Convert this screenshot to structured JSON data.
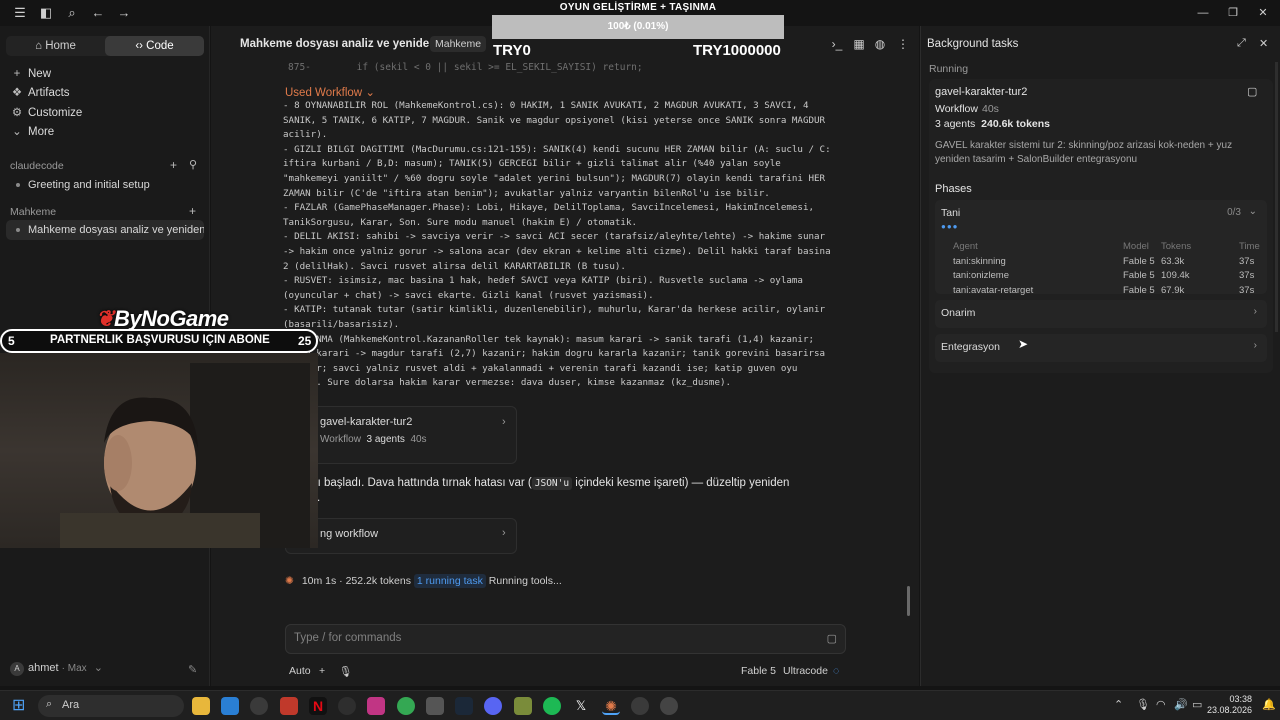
{
  "overlay": {
    "title": "OYUN GELİŞTİRME + TAŞINMA",
    "progress_text": "100₺ (0.01%)",
    "progress_fraction": 0.0001,
    "goal_start": "TRY0",
    "goal_end": "TRY1000000",
    "brand": "ByNoGame",
    "promo_left": "5",
    "promo_text": "PARTNERLIK BAŞVURUSU IÇIN ABONE",
    "promo_right": "25"
  },
  "sidebar": {
    "tabs": [
      {
        "label": "Home"
      },
      {
        "label": "Code"
      }
    ],
    "items": [
      {
        "label": "New",
        "icon": "plus-icon"
      },
      {
        "label": "Artifacts",
        "icon": "artifacts-icon"
      },
      {
        "label": "Customize",
        "icon": "customize-icon"
      },
      {
        "label": "More",
        "icon": "chevron-down-icon"
      }
    ],
    "section1": "claudecode",
    "section1_items": [
      "Greeting and initial setup"
    ],
    "section2": "Mahkeme",
    "section2_items": [
      "Mahkeme dosyası analiz ve yeniden ya"
    ],
    "user": {
      "initial": "A",
      "name": "ahmet",
      "plan": "· Max"
    }
  },
  "main": {
    "title": "Mahkeme dosyası analiz ve yeniden yazım",
    "tag": "Mahkeme",
    "code_top": "875-        if (sekil < 0 || sekil >= EL_SEKIL_SAYISI) return;",
    "workflow_label": "Used Workflow",
    "workflow_text": "- 8 OYNANABILIR ROL (MahkemeKontrol.cs): 0 HAKIM, 1 SANIK AVUKATI, 2 MAGDUR AVUKATI, 3 SAVCI, 4 SANIK, 5 TANIK, 6 KATIP, 7 MAGDUR. Sanik ve magdur opsiyonel (kisi yeterse once SANIK sonra MAGDUR acilir).\n- GIZLI BILGI DAGITIMI (MacDurumu.cs:121-155): SANIK(4) kendi sucunu HER ZAMAN bilir (A: suclu / C: iftira kurbani / B,D: masum); TANIK(5) GERCEGI bilir + gizli talimat alir (%40 yalan soyle \"mahkemeyi yaniilt\" / %60 dogru soyle \"adalet yerini bulsun\"); MAGDUR(7) olayin kendi tarafini HER ZAMAN bilir (C'de \"iftira atan benim\"); avukatlar yalniz varyantin bilenRol'u ise bilir.\n- FAZLAR (GamePhaseManager.Phase): Lobi, Hikaye, DelilToplama, SavciIncelemesi, HakimIncelemesi, TanikSorgusu, Karar, Son. Sure modu manuel (hakim E) / otomatik.\n- DELIL AKISI: sahibi -> savciya verir -> savci ACI secer (tarafsiz/aleyhte/lehte) -> hakime sunar -> hakim once yalniz gorur -> salona acar (dev ekran + kelime alti cizme). Delil hakki taraf basina 2 (delilHak). Savci rusvet alirsa delil KARARTABILIR (B tusu).\n- RUSVET: isimsiz, mac basina 1 hak, hedef SAVCI veya KATIP (biri). Rusvetle suclama -> oylama (oyuncular + chat) -> savci ekarte. Gizli kanal (rusvet yazismasi).\n- KATIP: tutanak tutar (satir kimlikli, duzenlenebilir), muhurlu, Karar'da herkese acilir, oylanir (basarili/basarisiz).\n- KAZANMA (MahkemeKontrol.KazananRoller tek kaynak): masum karari -> sanik tarafi (1,4) kazanir; suclu karari -> magdur tarafi (2,7) kazanir; hakim dogru kararla kazanir; tanik gorevini basarirsa kazanir; savci yalniz rusvet aldi + yakalanmadi + verenin tarafi kazandi ise; katip guven oyu alirsa. Sure dolarsa hakim karar vermezse: dava duser, kimse kazanmaz (kz_dusme).\n- SONUCLAR: SUCLU+sucluydu ucurum; SUCLU+masumdu beyaz kesme \"MASUMDU\"; MASUM+sucluydu(A) sanik siriti",
    "task_card": {
      "title": "gavel-karakter-tur2",
      "kind": "Workflow",
      "agents": "3 agents",
      "time": "40s"
    },
    "message_pre": "er hattı başladı. Dava hattında tırnak hatası var (",
    "message_code": "JSON'u",
    "message_post": " içindeki kesme işareti) — düzeltip yeniden\nyorum.",
    "workflow_card": "ng workflow",
    "status": {
      "time": "10m 1s",
      "tokens": "252.2k tokens",
      "running": "1 running task",
      "text": "Running tools..."
    },
    "input_placeholder": "Type / for commands",
    "bottom": {
      "mode": "Auto",
      "model": "Fable 5",
      "effort": "Ultracode"
    }
  },
  "panel": {
    "title": "Background tasks",
    "running_label": "Running",
    "task": {
      "name": "gavel-karakter-tur2",
      "kind": "Workflow",
      "time": "40s",
      "agents": "3 agents",
      "tokens": "240.6k tokens",
      "description": "GAVEL karakter sistemi tur 2: skinning/poz arizasi kok-neden + yuz yeniden tasarim + SalonBuilder entegrasyonu"
    },
    "phases_label": "Phases",
    "phases": [
      {
        "name": "Tani",
        "count": "0/3"
      },
      {
        "name": "Onarim",
        "count": ""
      },
      {
        "name": "Entegrasyon",
        "count": ""
      }
    ],
    "agent_headers": [
      "Agent",
      "Model",
      "Tokens",
      "Time"
    ],
    "agents": [
      {
        "agent": "tani:skinning",
        "model": "Fable 5",
        "tokens": "63.3k",
        "time": "37s"
      },
      {
        "agent": "tani:onizleme",
        "model": "Fable 5",
        "tokens": "109.4k",
        "time": "37s"
      },
      {
        "agent": "tani:avatar-retarget",
        "model": "Fable 5",
        "tokens": "67.9k",
        "time": "37s"
      }
    ]
  },
  "taskbar": {
    "search": "Ara",
    "time": "03:38",
    "date": "23.08.2026"
  }
}
